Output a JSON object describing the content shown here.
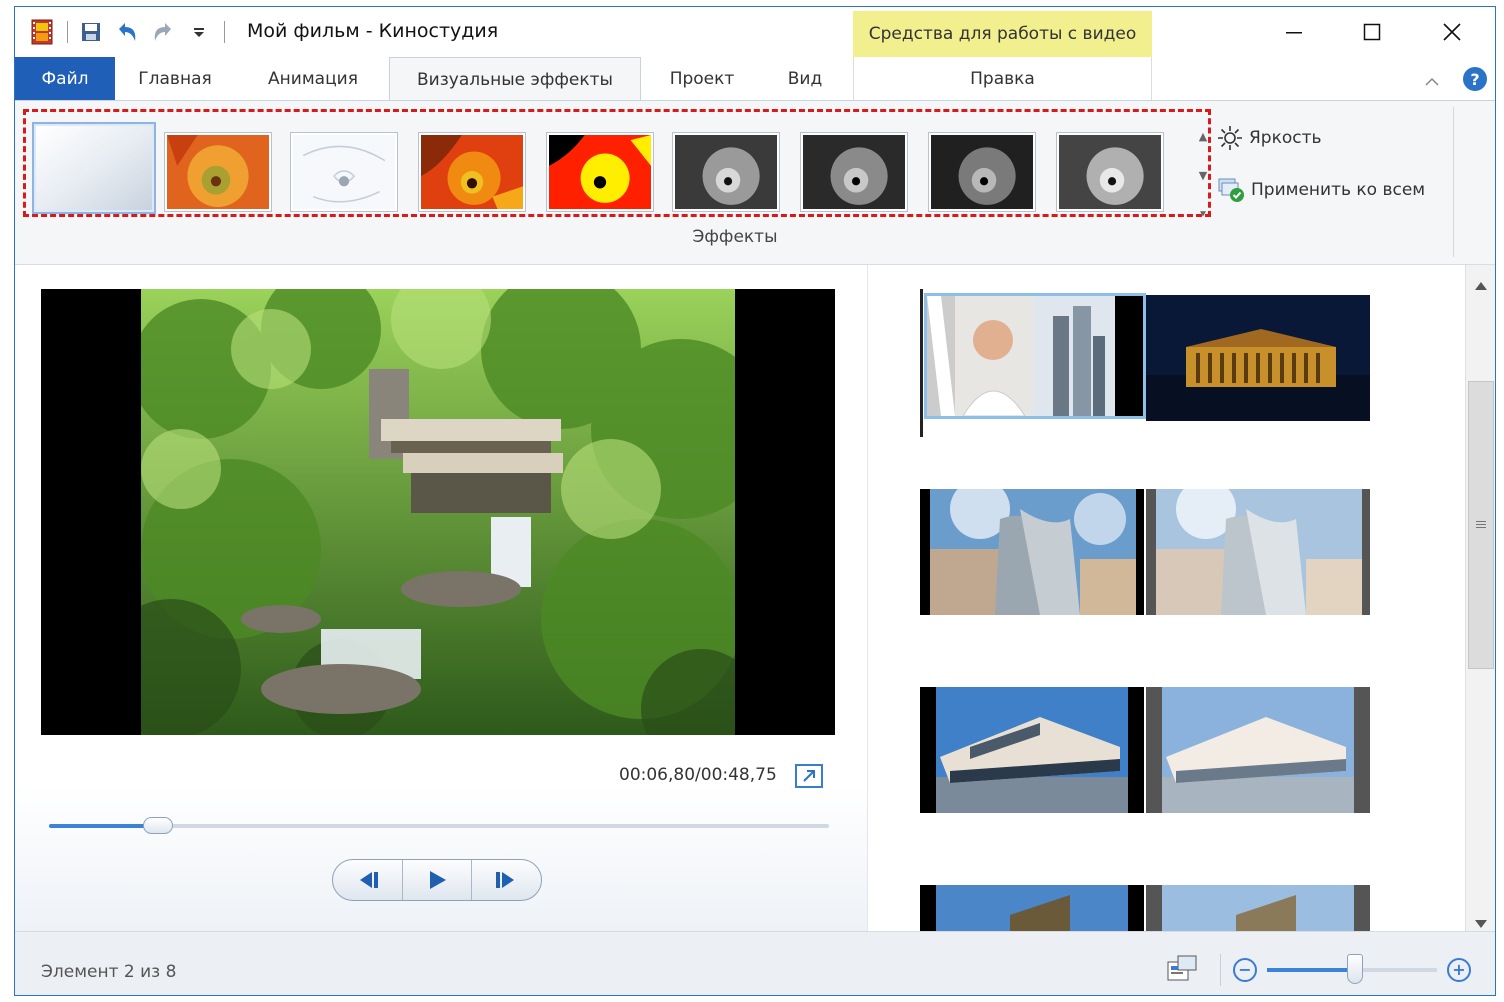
{
  "window": {
    "title": "Мой фильм - Киностудия",
    "context_header": "Средства для работы с видео",
    "context_tab": "Правка"
  },
  "tabs": [
    {
      "label": "Файл"
    },
    {
      "label": "Главная"
    },
    {
      "label": "Анимация"
    },
    {
      "label": "Визуальные эффекты"
    },
    {
      "label": "Проект"
    },
    {
      "label": "Вид"
    }
  ],
  "ribbon": {
    "brightness_label": "Яркость",
    "apply_all_label": "Применить ко всем",
    "group_label": "Эффекты",
    "effects": [
      "none",
      "posterize-orange",
      "edge-white",
      "posterize-red",
      "threshold-red-yellow",
      "grayscale-1",
      "grayscale-2",
      "grayscale-3",
      "grayscale-4"
    ]
  },
  "preview": {
    "time": "00:06,80/00:48,75",
    "progress": 0.14
  },
  "status": {
    "text": "Элемент 2 из 8",
    "zoom": 0.52
  },
  "colors": {
    "accent": "#1f5fb8",
    "context": "#f2ef8e",
    "highlight": "#d91a1a"
  }
}
